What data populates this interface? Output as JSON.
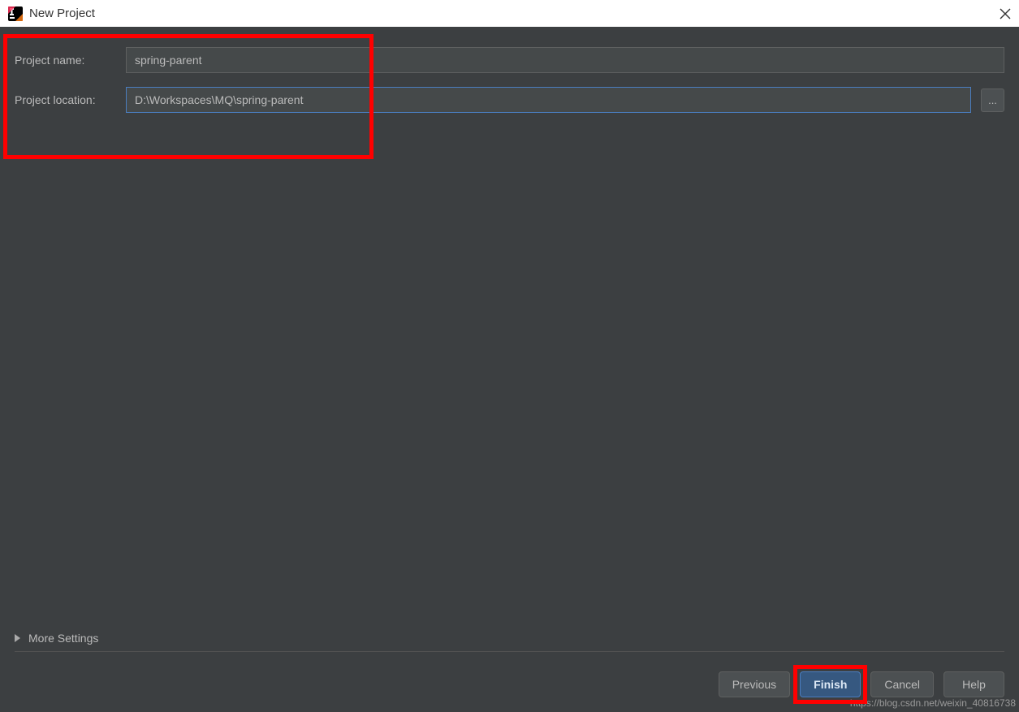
{
  "window": {
    "title": "New Project"
  },
  "form": {
    "project_name_label": "Project name:",
    "project_name_value": "spring-parent",
    "project_location_label": "Project location:",
    "project_location_value": "D:\\Workspaces\\MQ\\spring-parent",
    "browse_label": "..."
  },
  "more_settings": {
    "label": "More Settings"
  },
  "buttons": {
    "previous": "Previous",
    "finish": "Finish",
    "cancel": "Cancel",
    "help": "Help"
  },
  "watermark": "https://blog.csdn.net/weixin_40816738"
}
